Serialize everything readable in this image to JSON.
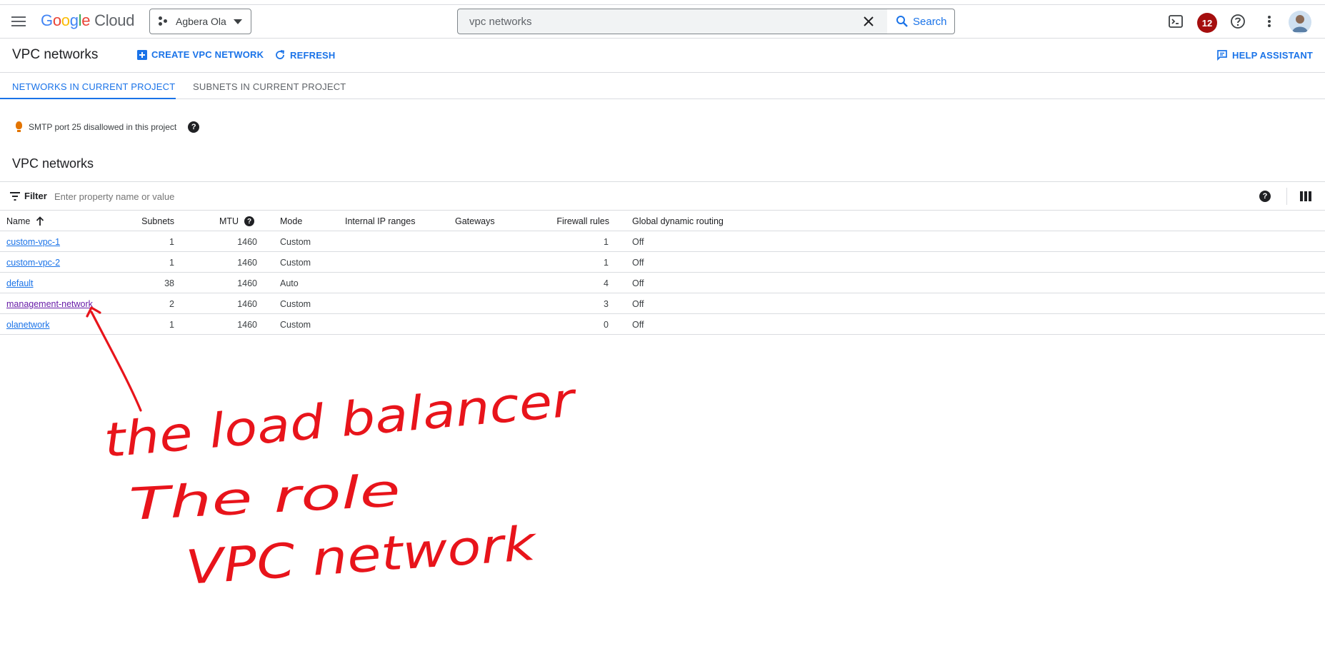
{
  "app": {
    "logo_google": [
      "G",
      "o",
      "o",
      "g",
      "l",
      "e"
    ],
    "logo_cloud": "Cloud",
    "project": "Agbera Ola",
    "search_value": "vpc networks",
    "search_button": "Search",
    "notification_count": "12"
  },
  "header": {
    "title": "VPC networks",
    "create_label": "CREATE VPC NETWORK",
    "refresh_label": "REFRESH",
    "help_assistant_label": "HELP ASSISTANT"
  },
  "tabs": [
    {
      "label": "NETWORKS IN CURRENT PROJECT",
      "active": true
    },
    {
      "label": "SUBNETS IN CURRENT PROJECT",
      "active": false
    }
  ],
  "notice": {
    "text": "SMTP port 25 disallowed in this project",
    "help": "?"
  },
  "section": {
    "title": "VPC networks"
  },
  "filter": {
    "label": "Filter",
    "placeholder": "Enter property name or value",
    "help": "?"
  },
  "table": {
    "columns": {
      "name": "Name",
      "subnets": "Subnets",
      "mtu": "MTU",
      "mode": "Mode",
      "internal_ip": "Internal IP ranges",
      "gateways": "Gateways",
      "firewall": "Firewall rules",
      "routing": "Global dynamic routing",
      "mtu_help": "?"
    },
    "rows": [
      {
        "name": "custom-vpc-1",
        "subnets": "1",
        "mtu": "1460",
        "mode": "Custom",
        "internal_ip": "",
        "gateways": "",
        "firewall": "1",
        "routing": "Off"
      },
      {
        "name": "custom-vpc-2",
        "subnets": "1",
        "mtu": "1460",
        "mode": "Custom",
        "internal_ip": "",
        "gateways": "",
        "firewall": "1",
        "routing": "Off"
      },
      {
        "name": "default",
        "subnets": "38",
        "mtu": "1460",
        "mode": "Auto",
        "internal_ip": "",
        "gateways": "",
        "firewall": "4",
        "routing": "Off"
      },
      {
        "name": "management-network",
        "subnets": "2",
        "mtu": "1460",
        "mode": "Custom",
        "internal_ip": "",
        "gateways": "",
        "firewall": "3",
        "routing": "Off"
      },
      {
        "name": "olanetwork",
        "subnets": "1",
        "mtu": "1460",
        "mode": "Custom",
        "internal_ip": "",
        "gateways": "",
        "firewall": "0",
        "routing": "Off"
      }
    ]
  },
  "annotation": {
    "color": "#e8141b",
    "lines": [
      "the load balancer",
      "The role",
      "VPC network"
    ]
  },
  "colors": {
    "accent": "#1a73e8",
    "badge": "#a50e0e",
    "visited_link": "#681da8",
    "bulb": "#e37400"
  }
}
